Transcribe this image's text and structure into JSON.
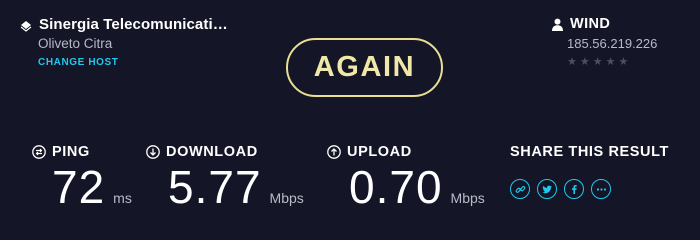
{
  "host": {
    "name": "Sinergia Telecomunicati…",
    "location": "Oliveto Citra",
    "change_label": "CHANGE HOST"
  },
  "again_label": "AGAIN",
  "isp": {
    "name": "WIND",
    "ip": "185.56.219.226",
    "rating_stars": 5,
    "rating_filled": 0
  },
  "metrics": {
    "ping": {
      "label": "PING",
      "value": "72",
      "unit": "ms"
    },
    "download": {
      "label": "DOWNLOAD",
      "value": "5.77",
      "unit": "Mbps"
    },
    "upload": {
      "label": "UPLOAD",
      "value": "0.70",
      "unit": "Mbps"
    }
  },
  "share": {
    "title": "SHARE THIS RESULT",
    "icons": [
      "link-icon",
      "twitter-icon",
      "facebook-icon",
      "more-icon"
    ]
  },
  "colors": {
    "background": "#141526",
    "accent": "#1fc8ee",
    "again_border": "#e9de92",
    "muted_text": "#b8bac7"
  }
}
